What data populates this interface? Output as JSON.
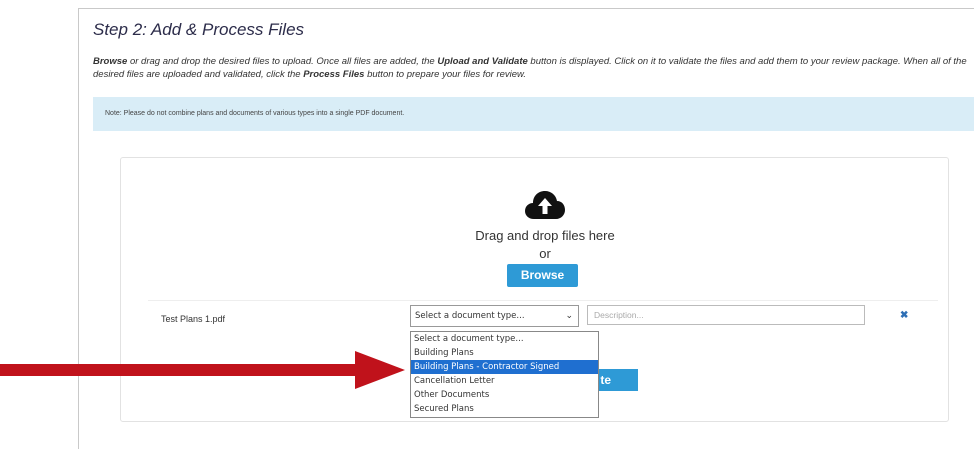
{
  "step_title": "Step 2: Add & Process Files",
  "instructions": {
    "browse": "Browse",
    "part1": " or drag and drop the desired files to upload. Once all files are added, the ",
    "upload_validate": "Upload and Validate",
    "part2": " button is displayed. Click on it to validate the files and add them to your review package. When all of the desired files are uploaded and validated, click the ",
    "process_files": "Process Files",
    "part3": " button to prepare your files for review."
  },
  "note": "Note: Please do not combine plans and documents of various types into a single PDF document.",
  "dropzone": {
    "drag_text": "Drag and drop files here",
    "or_text": "or",
    "browse_label": "Browse"
  },
  "file_row": {
    "file_name": "Test Plans 1.pdf",
    "select_value": "Select a document type...",
    "description_placeholder": "Description..."
  },
  "upload_button_visible_text": "te",
  "dropdown_options": [
    "Select a document type...",
    "Building Plans",
    "Building Plans - Contractor Signed",
    "Cancellation Letter",
    "Other Documents",
    "Secured Plans"
  ],
  "dropdown_selected_index": 2,
  "icons": {
    "cloud": "cloud-upload-icon",
    "remove": "close-icon",
    "chevron": "chevron-down-icon",
    "annotation": "red-arrow"
  },
  "colors": {
    "accent": "#2e9ad6",
    "note_bg": "#d9edf7",
    "highlight": "#1f6fd0",
    "arrow": "#c0121b"
  }
}
